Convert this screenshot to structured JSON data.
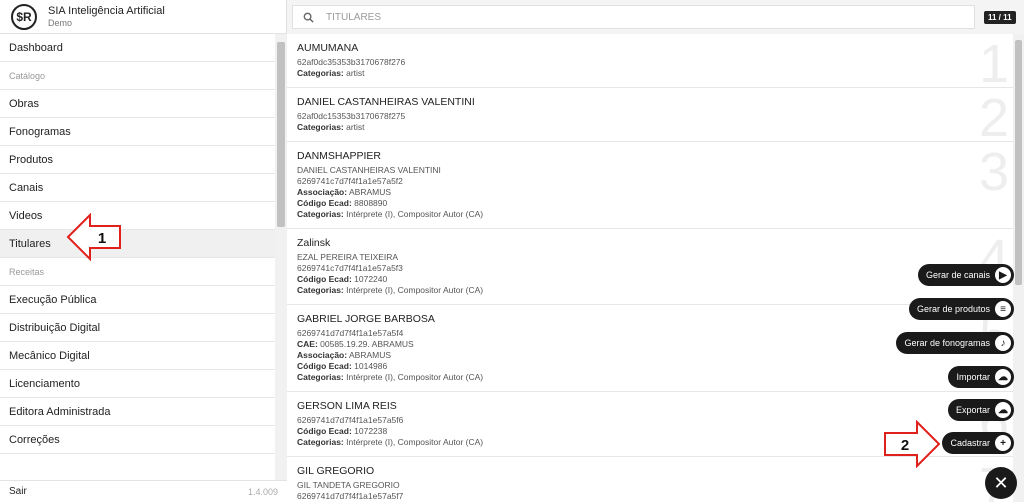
{
  "brand": {
    "logo": "$R",
    "title": "SIA Inteligência Artificial",
    "subtitle": "Demo"
  },
  "sidebar": {
    "items": [
      {
        "type": "item",
        "label": "Dashboard"
      },
      {
        "type": "section",
        "label": "Catálogo"
      },
      {
        "type": "item",
        "label": "Obras"
      },
      {
        "type": "item",
        "label": "Fonogramas"
      },
      {
        "type": "item",
        "label": "Produtos"
      },
      {
        "type": "item",
        "label": "Canais"
      },
      {
        "type": "item",
        "label": "Videos"
      },
      {
        "type": "item",
        "label": "Titulares",
        "active": true
      },
      {
        "type": "section",
        "label": "Receitas"
      },
      {
        "type": "item",
        "label": "Execução Pública"
      },
      {
        "type": "item",
        "label": "Distribuição Digital"
      },
      {
        "type": "item",
        "label": "Mecânico Digital"
      },
      {
        "type": "item",
        "label": "Licenciamento"
      },
      {
        "type": "item",
        "label": "Editora Administrada"
      },
      {
        "type": "item",
        "label": "Correções"
      }
    ],
    "footer": {
      "logout": "Sair",
      "version": "1.4.009"
    }
  },
  "search": {
    "placeholder": "TITULARES",
    "value": "",
    "count": "11 / 11",
    "icon": "search-icon"
  },
  "list": [
    {
      "num": "1",
      "name": "AUMUMANA",
      "lines": [
        {
          "v": "62af0dc35353b3170678f276"
        },
        {
          "k": "Categorias:",
          "v": " artist"
        }
      ]
    },
    {
      "num": "2",
      "name": "DANIEL CASTANHEIRAS VALENTINI",
      "lines": [
        {
          "v": "62af0dc15353b3170678f275"
        },
        {
          "k": "Categorias:",
          "v": " artist"
        }
      ]
    },
    {
      "num": "3",
      "name": "DANMSHAPPIER",
      "lines": [
        {
          "v": "DANIEL CASTANHEIRAS VALENTINI"
        },
        {
          "v": "6269741c7d7f4f1a1e57a5f2"
        },
        {
          "k": "Associação:",
          "v": " ABRAMUS"
        },
        {
          "k": "Código Ecad:",
          "v": " 8808890"
        },
        {
          "k": "Categorias:",
          "v": " Intérprete (I), Compositor Autor (CA)"
        }
      ]
    },
    {
      "num": "4",
      "name": "Zalinsk",
      "lines": [
        {
          "v": "EZAL PEREIRA TEIXEIRA"
        },
        {
          "v": "6269741c7d7f4f1a1e57a5f3"
        },
        {
          "k": "Código Ecad:",
          "v": " 1072240"
        },
        {
          "k": "Categorias:",
          "v": " Intérprete (I), Compositor Autor (CA)"
        }
      ]
    },
    {
      "num": "5",
      "name": "GABRIEL JORGE BARBOSA",
      "lines": [
        {
          "v": "6269741d7d7f4f1a1e57a5f4"
        },
        {
          "k": "CAE:",
          "v": " 00585.19.29. ABRAMUS"
        },
        {
          "k": "Associação:",
          "v": " ABRAMUS"
        },
        {
          "k": "Código Ecad:",
          "v": " 1014986"
        },
        {
          "k": "Categorias:",
          "v": " Intérprete (I), Compositor Autor (CA)"
        }
      ]
    },
    {
      "num": "6",
      "name": "GERSON LIMA REIS",
      "lines": [
        {
          "v": "6269741d7d7f4f1a1e57a5f6"
        },
        {
          "k": "Código Ecad:",
          "v": " 1072238"
        },
        {
          "k": "Categorias:",
          "v": " Intérprete (I), Compositor Autor (CA)"
        }
      ]
    },
    {
      "num": "7",
      "name": "GIL GREGORIO",
      "lines": [
        {
          "v": "GIL TANDETA GREGORIO"
        },
        {
          "v": "6269741d7d7f4f1a1e57a5f7"
        }
      ]
    }
  ],
  "fab": {
    "items": [
      {
        "label": "Gerar de canais",
        "icon": "play-icon",
        "glyph": "▶"
      },
      {
        "label": "Gerar de produtos",
        "icon": "stack-icon",
        "glyph": "≡"
      },
      {
        "label": "Gerar de fonogramas",
        "icon": "music-note-icon",
        "glyph": "♪"
      },
      {
        "label": "Importar",
        "icon": "cloud-upload-icon",
        "glyph": "☁"
      },
      {
        "label": "Exportar",
        "icon": "cloud-download-icon",
        "glyph": "☁"
      },
      {
        "label": "Cadastrar",
        "icon": "plus-icon",
        "glyph": "+"
      }
    ],
    "close_glyph": "✕"
  },
  "annotations": {
    "arrow_1": "1",
    "arrow_2": "2"
  },
  "colors": {
    "accent": "#1a1a1a",
    "arrow_stroke": "#e0201b"
  }
}
